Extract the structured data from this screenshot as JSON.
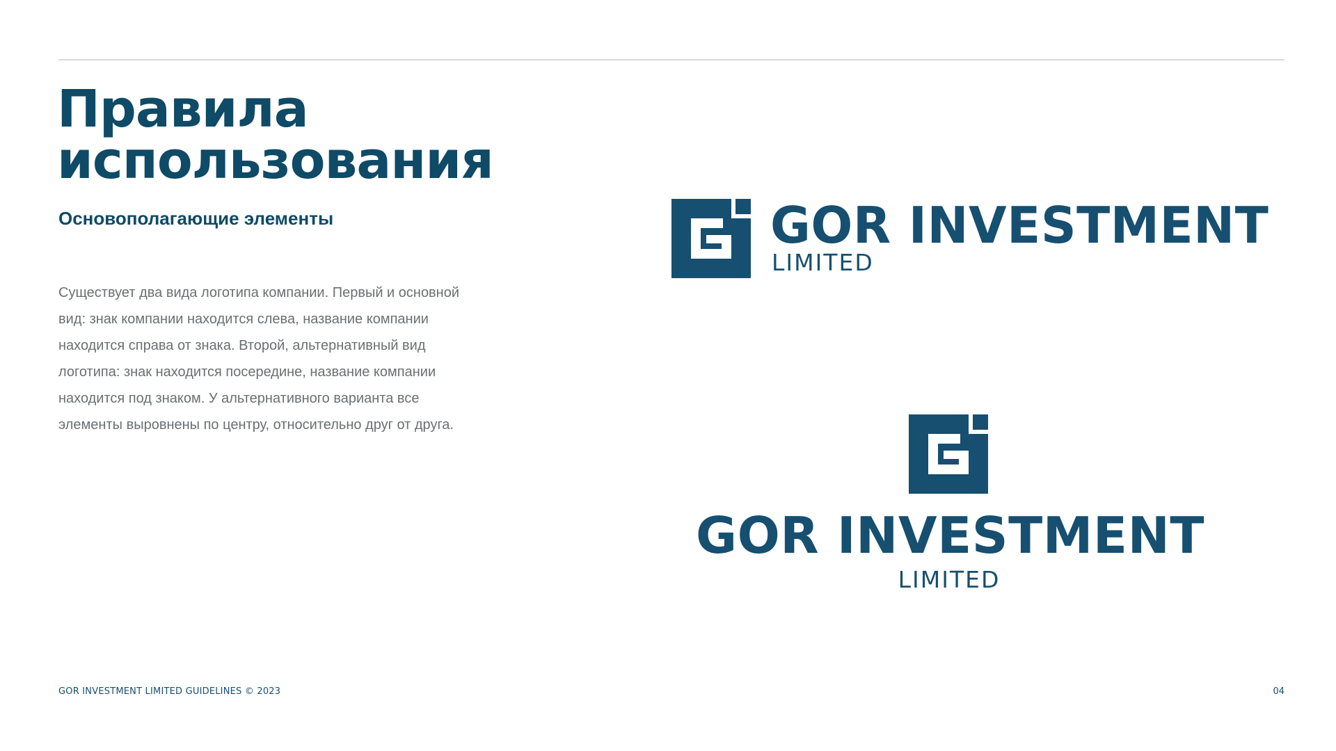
{
  "page": {
    "title_lines": [
      "Правила",
      "использования"
    ],
    "subtitle": "Основополагающие элементы",
    "body_lines": [
      "Существует два вида логотипа компании. Первый и основной",
      "вид: знак компании находится слева, название компании",
      "находится справа от знака. Второй, альтернативный вид",
      "логотипа: знак находится посередине, название компании",
      "находится под знаком. У альтернативного варианта все",
      "элементы выровнены по центру, относительно друг от друга."
    ]
  },
  "logos": {
    "horizontal": {
      "name": "GOR INVESTMENT",
      "sub": "LIMITED",
      "mark_icon": "gi-monogram-icon"
    },
    "centered": {
      "name": "GOR INVESTMENT",
      "sub": "LIMITED",
      "mark_icon": "gi-monogram-icon"
    }
  },
  "footer": {
    "left": "GOR INVESTMENT LIMITED GUIDELINES © 2023",
    "page_number": "04"
  },
  "colors": {
    "brand": "#164f70",
    "title": "#0f4a66",
    "body_text": "#6b6f72",
    "rule": "#d3dcdf",
    "background": "#ffffff"
  }
}
